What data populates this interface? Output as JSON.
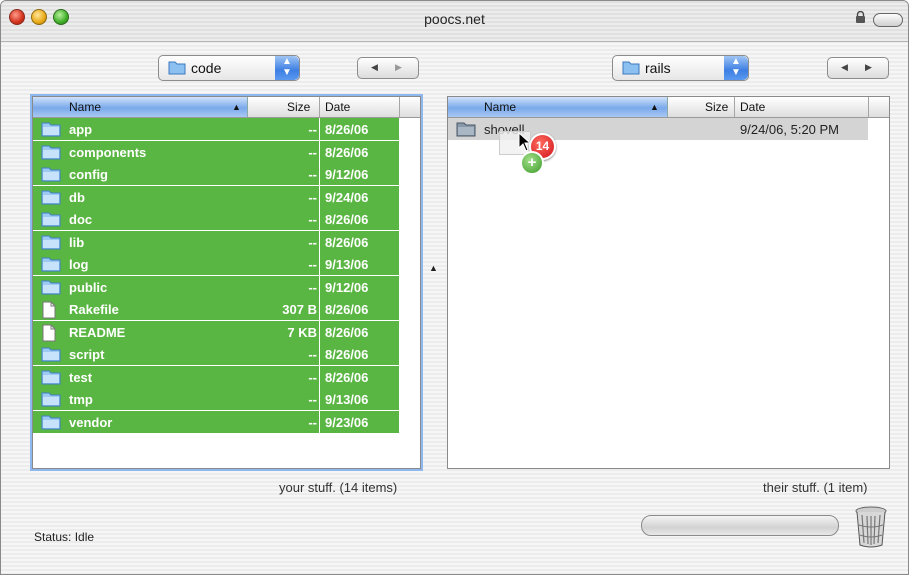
{
  "window": {
    "title": "poocs.net"
  },
  "left": {
    "location": "code",
    "columns": {
      "name": "Name",
      "size": "Size",
      "date": "Date"
    },
    "items": [
      {
        "name": "app",
        "type": "folder",
        "size": "--",
        "date": "8/26/06"
      },
      {
        "name": "components",
        "type": "folder",
        "size": "--",
        "date": "8/26/06"
      },
      {
        "name": "config",
        "type": "folder",
        "size": "--",
        "date": "9/12/06"
      },
      {
        "name": "db",
        "type": "folder",
        "size": "--",
        "date": "9/24/06"
      },
      {
        "name": "doc",
        "type": "folder",
        "size": "--",
        "date": "8/26/06"
      },
      {
        "name": "lib",
        "type": "folder",
        "size": "--",
        "date": "8/26/06"
      },
      {
        "name": "log",
        "type": "folder",
        "size": "--",
        "date": "9/13/06"
      },
      {
        "name": "public",
        "type": "folder",
        "size": "--",
        "date": "9/12/06"
      },
      {
        "name": "Rakefile",
        "type": "file",
        "size": "307 B",
        "date": "8/26/06"
      },
      {
        "name": "README",
        "type": "file",
        "size": "7 KB",
        "date": "8/26/06"
      },
      {
        "name": "script",
        "type": "folder",
        "size": "--",
        "date": "8/26/06"
      },
      {
        "name": "test",
        "type": "folder",
        "size": "--",
        "date": "8/26/06"
      },
      {
        "name": "tmp",
        "type": "folder",
        "size": "--",
        "date": "9/13/06"
      },
      {
        "name": "vendor",
        "type": "folder",
        "size": "--",
        "date": "9/23/06"
      }
    ],
    "footer": "your stuff. (14 items)"
  },
  "right": {
    "location": "rails",
    "columns": {
      "name": "Name",
      "size": "Size",
      "date": "Date"
    },
    "items": [
      {
        "name": "shovell",
        "type": "folder",
        "size": "",
        "date": "9/24/06, 5:20 PM"
      }
    ],
    "footer": "their stuff. (1 item)"
  },
  "drag": {
    "count": "14",
    "plus": "+"
  },
  "status": "Status: Idle",
  "colors": {
    "selection": "#5ab643",
    "accent": "#3d7fe3"
  }
}
